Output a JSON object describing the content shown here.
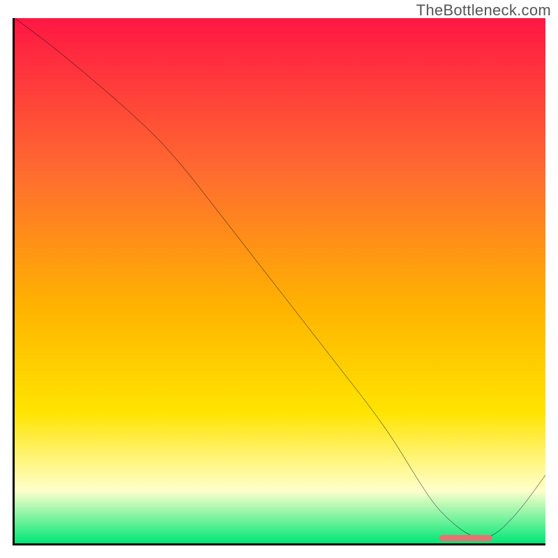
{
  "watermark": "TheBottleneck.com",
  "colors": {
    "top": "#ff1744",
    "mid1": "#ff6d2f",
    "mid2": "#ffb300",
    "mid3": "#ffe400",
    "pale": "#ffffcc",
    "bottom": "#00e676",
    "curve": "#000000",
    "marker": "#e57373"
  },
  "chart_data": {
    "type": "line",
    "title": "",
    "xlabel": "",
    "ylabel": "",
    "xlim": [
      0,
      100
    ],
    "ylim": [
      0,
      100
    ],
    "grid": false,
    "series": [
      {
        "name": "bottleneck-curve",
        "x": [
          0,
          8,
          22,
          30,
          40,
          50,
          60,
          70,
          76,
          80,
          86,
          90,
          95,
          100
        ],
        "values": [
          100,
          94,
          82,
          74,
          61,
          48,
          35,
          22,
          12,
          6,
          1,
          1,
          6,
          13
        ]
      }
    ],
    "annotations": [
      {
        "name": "optimal-marker",
        "x_range": [
          80,
          90
        ],
        "y": 1
      }
    ],
    "gradient_stops": [
      {
        "pos": 0.0,
        "color": "#ff1744"
      },
      {
        "pos": 0.3,
        "color": "#ff6d2f"
      },
      {
        "pos": 0.55,
        "color": "#ffb300"
      },
      {
        "pos": 0.75,
        "color": "#ffe400"
      },
      {
        "pos": 0.9,
        "color": "#ffffcc"
      },
      {
        "pos": 1.0,
        "color": "#00e676"
      }
    ]
  }
}
